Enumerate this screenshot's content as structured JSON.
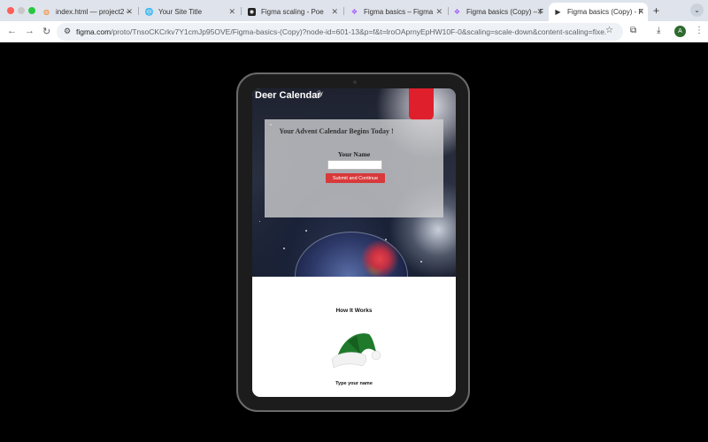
{
  "browser": {
    "tabs": [
      {
        "label": "index.html — project2 –",
        "icon": "sublime-icon"
      },
      {
        "label": "Your Site Title",
        "icon": "globe-icon"
      },
      {
        "label": "Figma scaling - Poe",
        "icon": "poe-icon"
      },
      {
        "label": "Figma basics – Figma",
        "icon": "figma-icon"
      },
      {
        "label": "Figma basics (Copy) – F",
        "icon": "figma-icon"
      },
      {
        "label": "Figma basics (Copy) - F",
        "icon": "play-icon"
      }
    ],
    "url_host": "figma.com",
    "url_path": "/proto/TnsoCKCrkv7Y1cmJp95OVE/Figma-basics-(Copy)?node-id=601-13&p=f&t=lroOAprnyEpHW10F-0&scaling=scale-down&content-scaling=fixe...",
    "avatar_letter": "A"
  },
  "prototype": {
    "site_title": "Deer Calendar",
    "card_heading": "Your Advent Calendar Begins Today !",
    "name_label": "Your Name",
    "name_value": "",
    "submit_label": "Submit and Continue",
    "section_title": "How It Works",
    "step_caption": "Type your name"
  },
  "colors": {
    "accent_red": "#d8393a",
    "chrome_tabbar": "#dfe3eb"
  }
}
